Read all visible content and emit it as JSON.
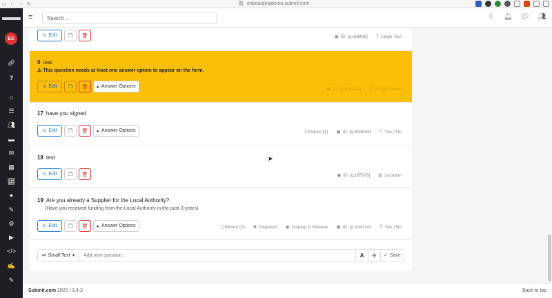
{
  "browser": {
    "url": "onboardingdemo.submit.com"
  },
  "sidebar": {
    "avatar_initials": "ES",
    "icons": [
      "link-icon",
      "question-icon",
      "home-icon",
      "list-icon",
      "users-icon",
      "folder-icon",
      "inbox-icon",
      "calendar-icon",
      "chart-icon",
      "user-icon",
      "brush-icon",
      "gear-icon",
      "video-icon",
      "code-icon",
      "edit-icon"
    ]
  },
  "topbar": {
    "search_placeholder": "Search..."
  },
  "buttons": {
    "edit": "Edit",
    "answer_options": "Answer Options"
  },
  "top_card": {
    "meta_id": "ID: [q:a6bf36]",
    "meta_type": "Large Text"
  },
  "warn_card": {
    "number": "0",
    "question": "test",
    "warning": "This question needs at least one answer option to appear on the form.",
    "meta_id": "ID: [q:bd0e1d]",
    "meta_type": "Single Select"
  },
  "questions": [
    {
      "number": "17",
      "text": "have you signed",
      "meta_children": "Children (1)",
      "meta_id": "ID: [q:6bdb48]",
      "meta_type": "Yes / No"
    },
    {
      "number": "18",
      "text": "test",
      "meta_id": "ID: [q:bf7678]",
      "meta_type": "Location"
    },
    {
      "number": "19",
      "text": "Are you already a Supplier for the Local Authority?",
      "subtext": "(Have you received funding from the Local Authority in the past 3 years)",
      "meta_children": "Children (2)",
      "meta_required": "Required",
      "meta_display": "Display in Preview",
      "meta_id": "ID: [q:bd412d]",
      "meta_type": "Yes / No"
    }
  ],
  "add_question": {
    "type_label": "Small Text",
    "placeholder": "Add new question...",
    "save_label": "Save"
  },
  "footer": {
    "brand": "Submit.com",
    "year_version": "2025 | 3.4.3",
    "back_to_top": "Back to top"
  },
  "colors": {
    "warning_bg": "#fbbf0a",
    "primary": "#1c7ed6",
    "danger": "#e03131",
    "sidebar_bg": "#1e1f24"
  }
}
